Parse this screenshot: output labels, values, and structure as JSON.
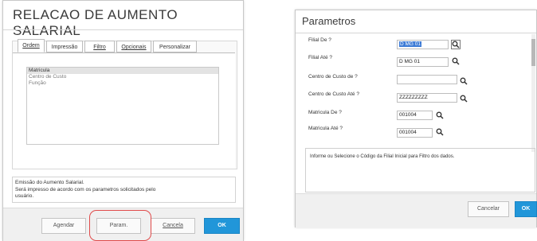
{
  "left_dialog": {
    "title": "RELACAO DE AUMENTO SALARIAL",
    "tabs": [
      {
        "label": "Ordem",
        "active": true
      },
      {
        "label": "Impressão",
        "active": false
      },
      {
        "label": "Filtro",
        "active": false
      },
      {
        "label": "Opcionais",
        "active": false
      },
      {
        "label": "Personalizar",
        "active": false
      }
    ],
    "order_list": [
      "Matricula",
      "Centro de Custo",
      "Função"
    ],
    "selected_index": 0,
    "description": [
      "Emissão do Aumento Salarial.",
      "Será impresso de acordo com os parametros solicitados pelo",
      "usuário."
    ],
    "buttons": {
      "schedule": "Agendar",
      "params": "Param.",
      "cancel": "Cancela",
      "ok": "OK"
    }
  },
  "right_dialog": {
    "title": "Parametros",
    "fields": [
      {
        "label": "Filial De ?",
        "value": "D MG 01"
      },
      {
        "label": "Filial Até ?",
        "value": "D MG 01"
      },
      {
        "label": "Centro de Custo de ?",
        "value": ""
      },
      {
        "label": "Centro de Custo Até ?",
        "value": "ZZZZZZZZZ"
      },
      {
        "label": "Matricula De ?",
        "value": "001004"
      },
      {
        "label": "Matricula Até ?",
        "value": "001004"
      }
    ],
    "help_text": "Informe ou Selecione o Código da Filial Inicial para Filtro dos dados.",
    "buttons": {
      "cancel": "Cancelar",
      "ok": "OK"
    }
  },
  "colors": {
    "accent": "#2196d9",
    "highlight": "#e04a4a",
    "selection": "#3d7bd6"
  }
}
